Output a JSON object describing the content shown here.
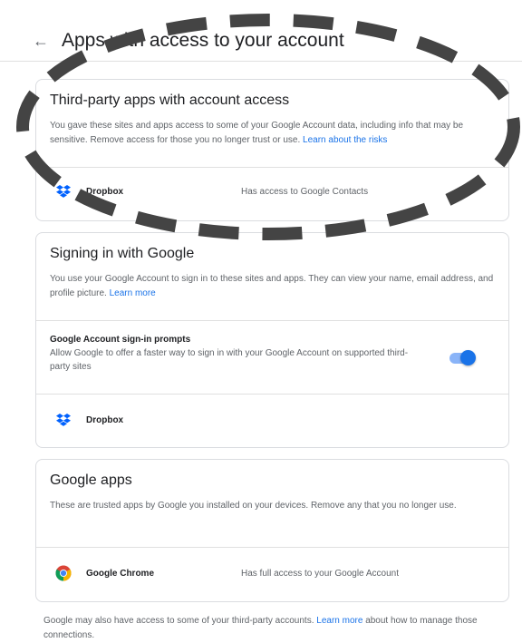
{
  "header": {
    "title": "Apps with access to your account",
    "back_glyph": "←"
  },
  "third_party": {
    "title": "Third-party apps with account access",
    "description": "You gave these sites and apps access to some of your Google Account data, including info that may be sensitive. Remove access for those you no longer trust or use.",
    "link": "Learn about the risks",
    "apps": [
      {
        "name": "Dropbox",
        "access": "Has access to Google Contacts",
        "icon": "dropbox-icon"
      }
    ]
  },
  "signin": {
    "title": "Signing in with Google",
    "description": "You use your Google Account to sign in to these sites and apps. They can view your name, email address, and profile picture.",
    "link": "Learn more",
    "prompts": {
      "title": "Google Account sign-in prompts",
      "description": "Allow Google to offer a faster way to sign in with your Google Account on supported third-party sites",
      "enabled": true
    },
    "apps": [
      {
        "name": "Dropbox",
        "icon": "dropbox-icon"
      }
    ]
  },
  "google_apps": {
    "title": "Google apps",
    "description": "These are trusted apps by Google you installed on your devices. Remove any that you no longer use.",
    "apps": [
      {
        "name": "Google Chrome",
        "access": "Has full access to your Google Account",
        "icon": "chrome-icon"
      }
    ]
  },
  "footer": {
    "text_before": "Google may also have access to some of your third-party accounts.",
    "link": "Learn more",
    "text_after": "about how to manage those connections."
  },
  "colors": {
    "link": "#1a73e8",
    "dropbox": "#0061fe",
    "annotation": "#444444"
  }
}
